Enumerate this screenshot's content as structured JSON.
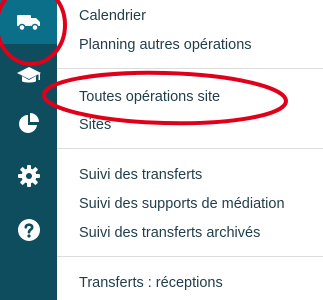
{
  "colors": {
    "rail": "#0d4d5e",
    "rail_active": "#0b6f8a",
    "text": "#1f3d4a",
    "annotation": "#e0001a"
  },
  "rail": {
    "items": [
      {
        "icon": "truck-icon",
        "active": true
      },
      {
        "icon": "graduation-cap-icon",
        "active": false
      },
      {
        "icon": "pie-chart-icon",
        "active": false
      },
      {
        "icon": "gear-icon",
        "active": false
      },
      {
        "icon": "help-icon",
        "active": false
      }
    ]
  },
  "menu": {
    "group1": [
      "Calendrier",
      "Planning autres opérations"
    ],
    "group2": [
      "Toutes opérations site",
      "Sites"
    ],
    "group3": [
      "Suivi des transferts",
      "Suivi des supports de médiation",
      "Suivi des transferts archivés"
    ],
    "group4": [
      "Transferts : réceptions"
    ]
  }
}
